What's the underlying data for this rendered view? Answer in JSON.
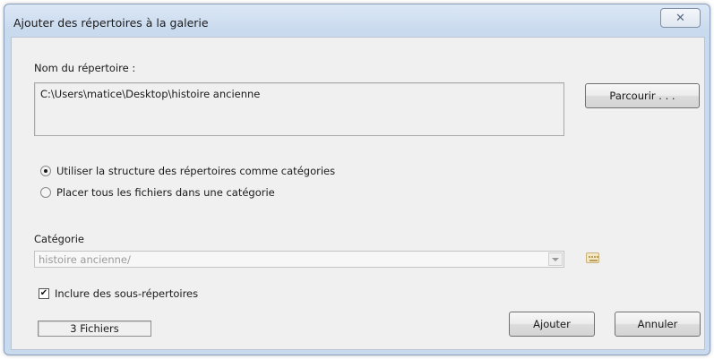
{
  "window": {
    "title": "Ajouter des répertoires à la galerie",
    "close_label": "✕"
  },
  "directory": {
    "label": "Nom du répertoire :",
    "value": "C:\\Users\\matice\\Desktop\\histoire ancienne",
    "browse_label": "Parcourir . . ."
  },
  "options": {
    "structure_label": "Utiliser la structure des répertoires comme catégories",
    "structure_selected": true,
    "single_label": "Placer tous les fichiers dans une catégorie",
    "single_selected": false
  },
  "category": {
    "label": "Catégorie",
    "value": "histoire ancienne/",
    "icon": "keyboard-icon"
  },
  "include_subdirs": {
    "label": "Inclure des sous-répertoires",
    "checked": true
  },
  "status": {
    "file_count": "3 Fichiers"
  },
  "buttons": {
    "add_label": "Ajouter",
    "cancel_label": "Annuler"
  }
}
